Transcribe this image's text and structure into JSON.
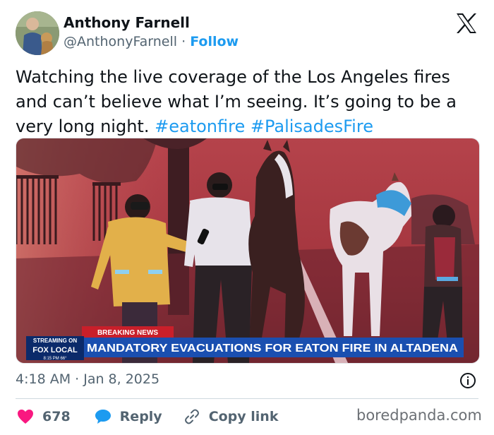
{
  "author": {
    "name": "Anthony Farnell",
    "handle": "@AnthonyFarnell",
    "separator": "·",
    "follow_label": "Follow"
  },
  "tweet": {
    "text": "Watching the live coverage of the Los Angeles fires and can’t believe what I’m seeing. It’s going to be a very long night.",
    "hashtags": [
      "#eatonfire",
      "#PalisadesFire"
    ]
  },
  "media": {
    "breaking_label": "BREAKING NEWS",
    "streaming_label": "STREAMING ON",
    "channel_logo": "FOX LOCAL",
    "headline": "MANDATORY EVACUATIONS FOR EATON FIRE IN ALTADENA",
    "clock": "8:15 PM   66°"
  },
  "meta": {
    "timestamp": "4:18 AM · Jan 8, 2025"
  },
  "actions": {
    "like_count": "678",
    "reply_label": "Reply",
    "copy_label": "Copy link"
  },
  "watermark": "boredpanda.com",
  "colors": {
    "link": "#1d9bf0",
    "like": "#f91880",
    "reply_icon": "#1d9bf0",
    "text_secondary": "#536471",
    "ticker_blue": "#1a4fb0"
  },
  "icons": [
    "x-logo-icon",
    "info-icon",
    "heart-icon",
    "reply-bubble-icon",
    "link-icon"
  ]
}
